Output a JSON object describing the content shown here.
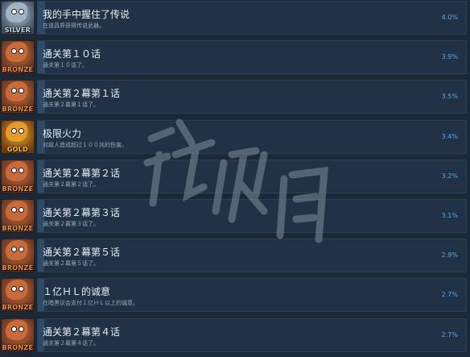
{
  "achievements": [
    {
      "tier": "SILVER",
      "title": "我的手中握住了传说",
      "desc": "在道具界获得传说武器。",
      "percent": "4.0%",
      "fraction": 0.04
    },
    {
      "tier": "BRONZE",
      "title": "通关第１０话",
      "desc": "通关第１０话了。",
      "percent": "3.9%",
      "fraction": 0.039
    },
    {
      "tier": "BRONZE",
      "title": "通关第２幕第１话",
      "desc": "通关第２幕第１话了。",
      "percent": "3.5%",
      "fraction": 0.035
    },
    {
      "tier": "GOLD",
      "title": "极限火力",
      "desc": "对敌人造成超过１００兆的伤害。",
      "percent": "3.4%",
      "fraction": 0.034
    },
    {
      "tier": "BRONZE",
      "title": "通关第２幕第２话",
      "desc": "通关第２幕第２话了。",
      "percent": "3.2%",
      "fraction": 0.032
    },
    {
      "tier": "BRONZE",
      "title": "通关第２幕第３话",
      "desc": "通关第２幕第３话了。",
      "percent": "3.1%",
      "fraction": 0.031
    },
    {
      "tier": "BRONZE",
      "title": "通关第２幕第５话",
      "desc": "通关第２幕第５话了。",
      "percent": "2.9%",
      "fraction": 0.029
    },
    {
      "tier": "BRONZE",
      "title": "１亿ＨＬ的诚意",
      "desc": "在暗黑议会支付１亿ＨＬ以上的诚意。",
      "percent": "2.7%",
      "fraction": 0.027
    },
    {
      "tier": "BRONZE",
      "title": "通关第２幕第４话",
      "desc": "通关第２幕第４话了。",
      "percent": "2.7%",
      "fraction": 0.027
    }
  ],
  "tier_colors": {
    "SILVER": "#c9d3dc",
    "BRONZE": "#e8904a",
    "GOLD": "#f4c430"
  },
  "watermark": {
    "text": "游侠网",
    "color": "#8a97a3"
  }
}
